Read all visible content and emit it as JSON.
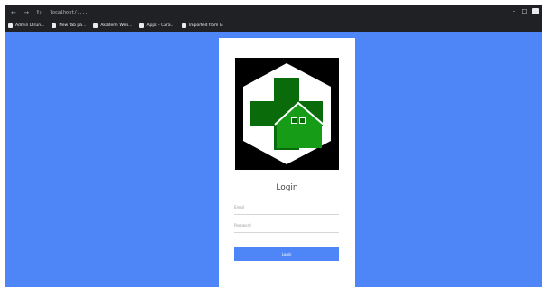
{
  "browser": {
    "back_glyph": "←",
    "forward_glyph": "→",
    "reload_glyph": "↻",
    "url": "localhost/....",
    "bookmarks": [
      {
        "icon": "bookmark-icon",
        "label": "Admin Dirun..."
      },
      {
        "icon": "bookmark-icon",
        "label": "New tab pa..."
      },
      {
        "icon": "bookmark-icon",
        "label": "Akademi Web..."
      },
      {
        "icon": "bookmark-icon",
        "label": "Apps - Cara..."
      },
      {
        "icon": "bookmark-icon",
        "label": "Imported from IE"
      }
    ],
    "controls": {
      "minimize": "–",
      "maximize": "□",
      "close": "×"
    }
  },
  "colors": {
    "background": "#4f86f7",
    "card": "#ffffff",
    "logo_background": "#000000",
    "logo_green_dark": "#0a6b0a",
    "logo_green_light": "#169c16",
    "button": "#4f86f7"
  },
  "login": {
    "logo_icon": "health-cross-house-logo",
    "title": "Login",
    "email_placeholder": "Email",
    "password_placeholder": "Password",
    "button_label": "Login"
  }
}
